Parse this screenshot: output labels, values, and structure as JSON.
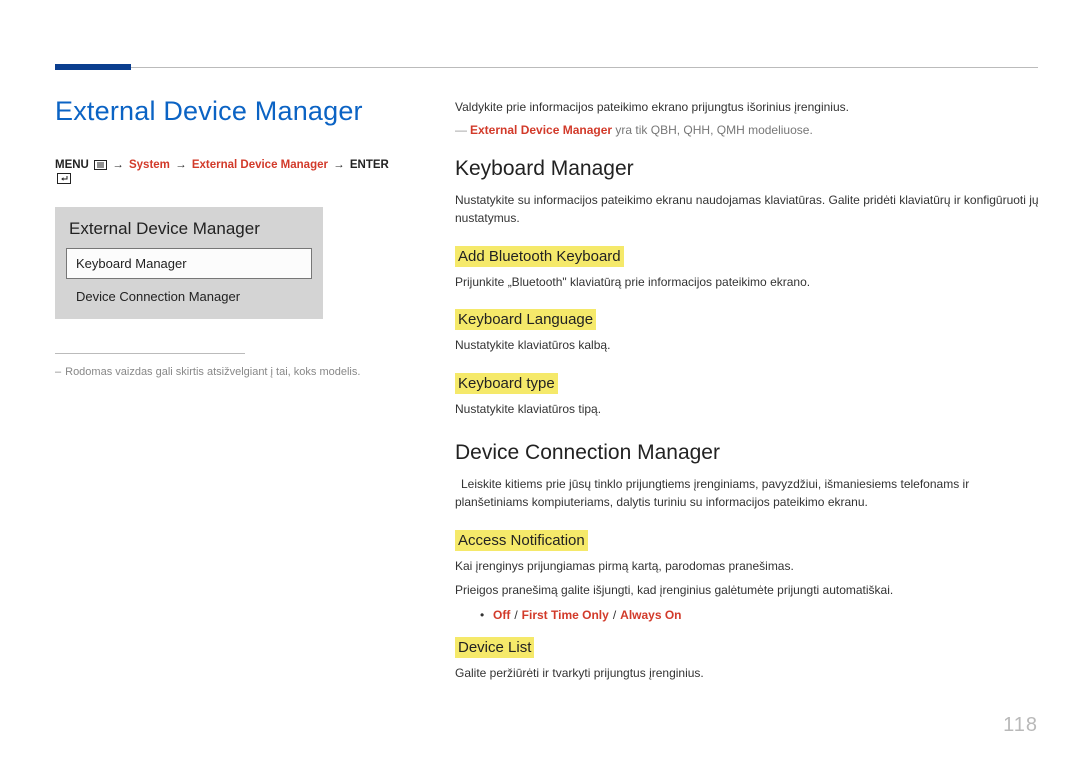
{
  "page_number": "118",
  "left": {
    "h1": "External Device Manager",
    "path": {
      "menu": "MENU",
      "system": "System",
      "edm": "External Device Manager",
      "enter": "ENTER"
    },
    "panel": {
      "title": "External Device Manager",
      "row_selected": "Keyboard Manager",
      "row_plain": "Device Connection Manager"
    },
    "footnote": "Rodomas vaizdas gali skirtis atsižvelgiant į tai, koks modelis."
  },
  "right": {
    "intro": "Valdykite prie informacijos pateikimo ekrano prijungtus išorinius įrenginius.",
    "note_red": "External Device Manager",
    "note_tail": " yra tik QBH, QHH, QMH modeliuose.",
    "km": {
      "h2": "Keyboard Manager",
      "desc": "Nustatykite su informacijos pateikimo ekranu naudojamas klaviatūras. Galite pridėti klaviatūrų ir konfigūruoti jų nustatymus.",
      "add_bt": "Add Bluetooth Keyboard",
      "add_bt_desc": "Prijunkite „Bluetooth\" klaviatūrą prie informacijos pateikimo ekrano.",
      "lang": "Keyboard Language",
      "lang_desc": "Nustatykite klaviatūros kalbą.",
      "type": "Keyboard type",
      "type_desc": "Nustatykite klaviatūros tipą."
    },
    "dcm": {
      "h2": "Device Connection Manager",
      "desc": "Leiskite kitiems prie jūsų tinklo prijungtiems įrenginiams, pavyzdžiui, išmaniesiems telefonams ir planšetiniams kompiuteriams, dalytis turiniu su informacijos pateikimo ekranu.",
      "access": "Access Notification",
      "access_desc1": "Kai įrenginys prijungiamas pirmą kartą, parodomas pranešimas.",
      "access_desc2": "Prieigos pranešimą galite išjungti, kad įrenginius galėtumėte prijungti automatiškai.",
      "options": {
        "off": "Off",
        "fto": "First Time Only",
        "always": "Always On"
      },
      "devlist": "Device List",
      "devlist_desc": "Galite peržiūrėti ir tvarkyti prijungtus įrenginius."
    }
  }
}
